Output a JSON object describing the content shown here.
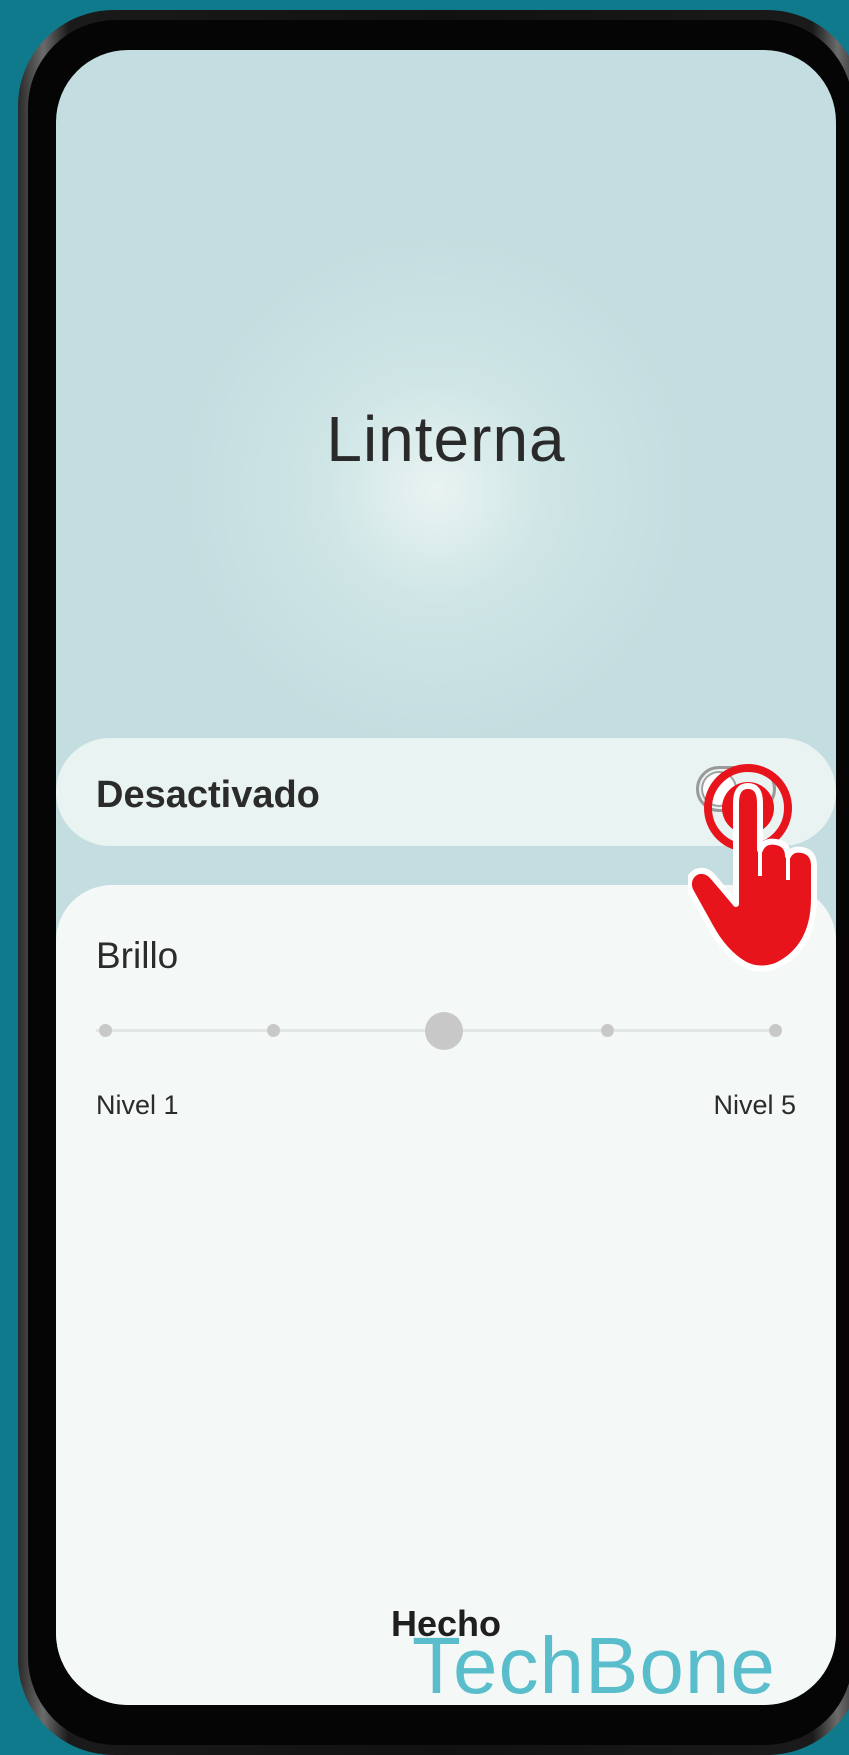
{
  "screen": {
    "title": "Linterna"
  },
  "toggle": {
    "label": "Desactivado",
    "state": "off"
  },
  "brightness": {
    "label": "Brillo",
    "levels": 5,
    "current_level": 3,
    "min_label": "Nivel 1",
    "max_label": "Nivel 5"
  },
  "footer": {
    "done_label": "Hecho"
  },
  "watermark": {
    "text": "TechBone"
  },
  "colors": {
    "background": "#0f7a8c",
    "screen_top": "#c3dde0",
    "panel": "#f4f8f7",
    "tap_indicator": "#e8141c"
  },
  "icons": {
    "tap_hint": "hand-pointer-icon"
  }
}
